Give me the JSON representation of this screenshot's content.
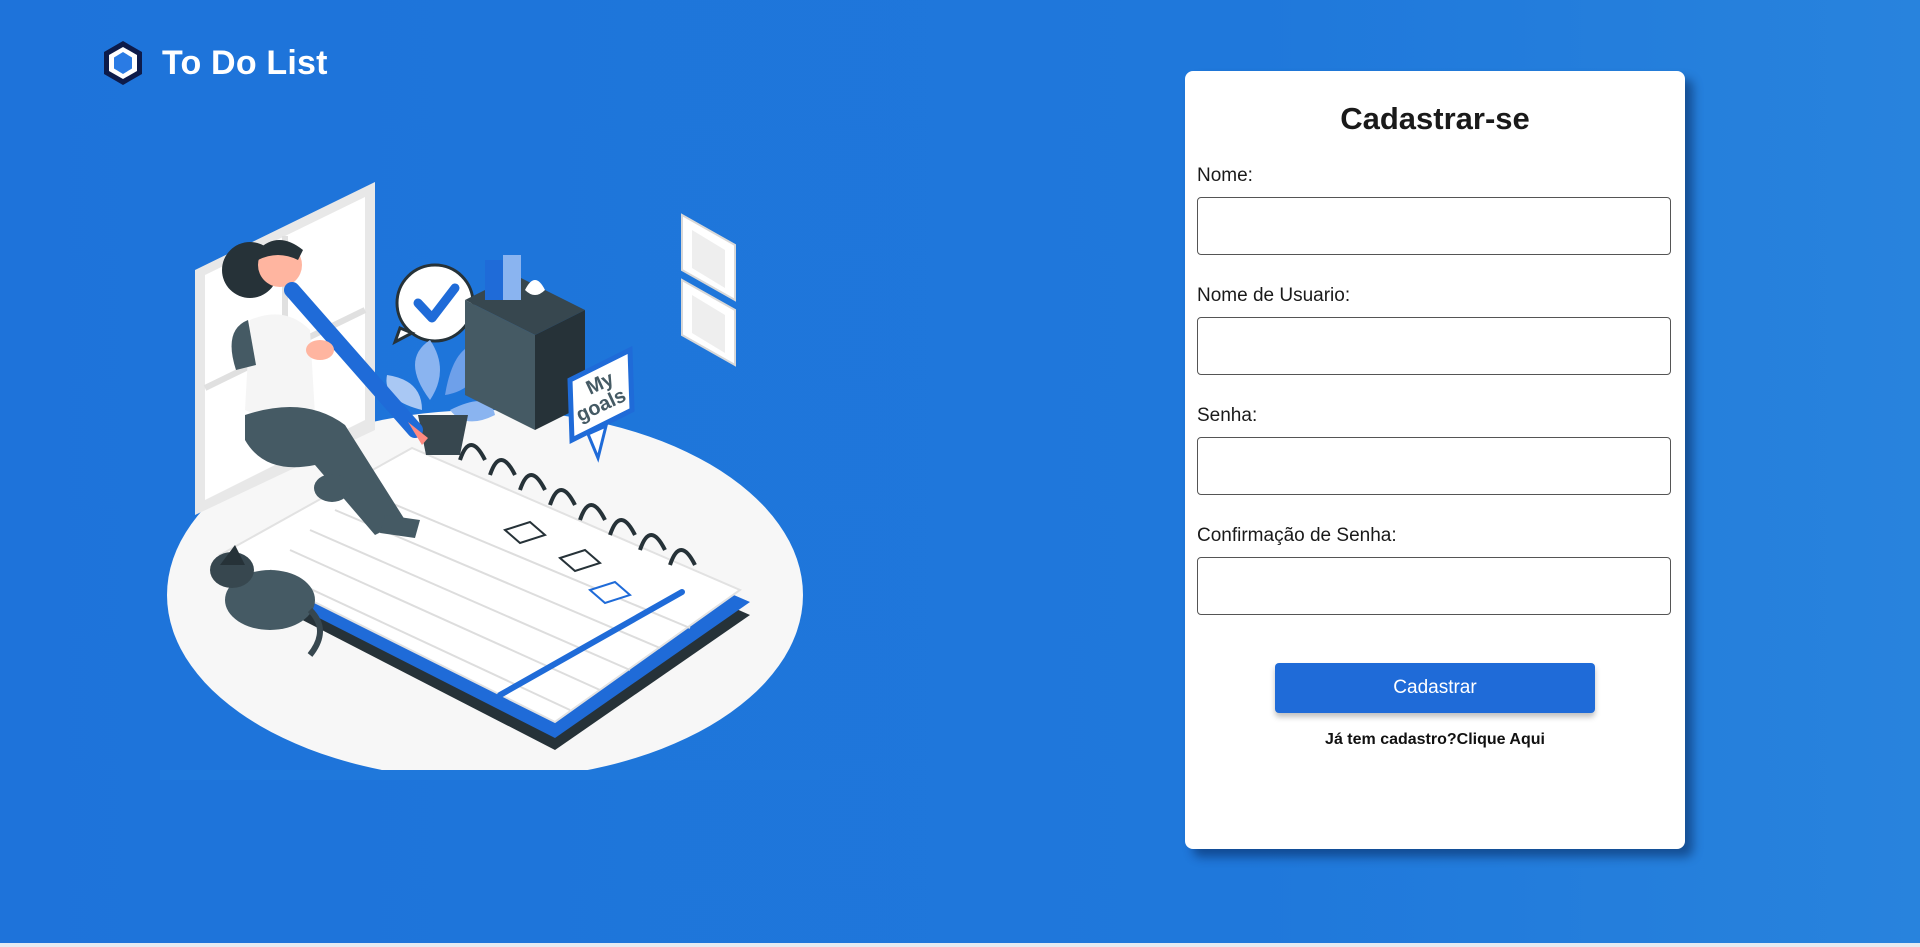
{
  "brand": {
    "title": "To Do List",
    "logo_icon": "hexagon-logo-icon",
    "logo_outer_color": "#0d1b4a",
    "logo_inner_color": "#2a7be4"
  },
  "illustration": {
    "name": "woman-writing-goals-illustration",
    "sign_text_line1": "My",
    "sign_text_line2": "goals"
  },
  "form": {
    "title": "Cadastrar-se",
    "fields": [
      {
        "label": "Nome:",
        "value": "",
        "placeholder": ""
      },
      {
        "label": "Nome de Usuario:",
        "value": "",
        "placeholder": ""
      },
      {
        "label": "Senha:",
        "value": "",
        "placeholder": ""
      },
      {
        "label": "Confirmação de Senha:",
        "value": "",
        "placeholder": ""
      }
    ],
    "submit_label": "Cadastrar",
    "login_prompt": "Já tem cadastro?",
    "login_link": "Clique Aqui"
  },
  "colors": {
    "background": "#1f78db",
    "card": "#ffffff",
    "button": "#1f6bd8"
  }
}
